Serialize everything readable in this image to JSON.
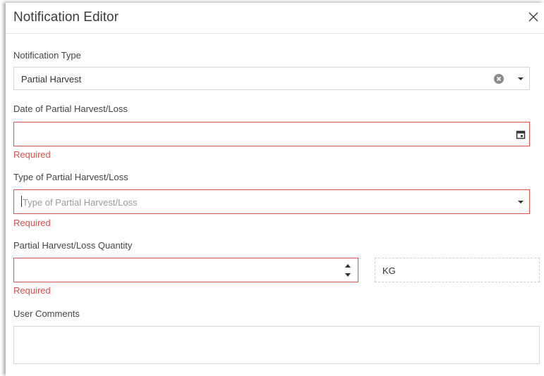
{
  "dialog": {
    "title": "Notification Editor",
    "close_icon": "close-icon"
  },
  "notification_type": {
    "label": "Notification Type",
    "value": "Partial Harvest",
    "clear_icon": "clear-circle-icon",
    "dropdown_icon": "caret-down-icon"
  },
  "date_field": {
    "label": "Date of Partial Harvest/Loss",
    "value": "",
    "calendar_icon": "calendar-icon",
    "error": "Required"
  },
  "type_field": {
    "label": "Type of Partial Harvest/Loss",
    "placeholder": "Type of Partial Harvest/Loss",
    "dropdown_icon": "caret-down-icon",
    "error": "Required"
  },
  "quantity_field": {
    "label": "Partial Harvest/Loss Quantity",
    "value": "",
    "spinner_icons": [
      "spin-up-icon",
      "spin-down-icon"
    ],
    "unit": "KG",
    "error": "Required"
  },
  "comments": {
    "label": "User Comments",
    "value": ""
  },
  "colors": {
    "error": "#d9534f",
    "border": "#d6d6d6"
  }
}
